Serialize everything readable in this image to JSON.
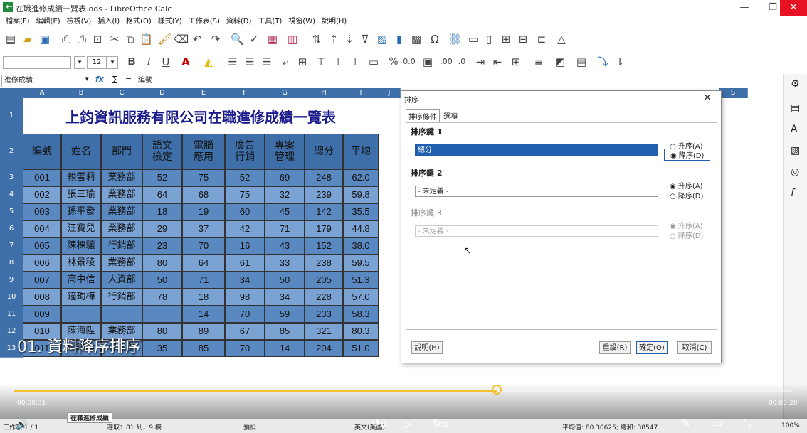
{
  "window": {
    "title": "在職進修成績一覽表.ods - LibreOffice Calc",
    "min_icon": "—",
    "max_icon": "❐",
    "close_icon": "✕",
    "back_icon": "←"
  },
  "menu": [
    "檔案(F)",
    "編輯(E)",
    "檢視(V)",
    "插入(I)",
    "格式(O)",
    "樣式(Y)",
    "工作表(S)",
    "資料(D)",
    "工具(T)",
    "視窗(W)",
    "說明(H)"
  ],
  "font_size": "12",
  "formula": {
    "name_box": "進修成績",
    "fx": "fx",
    "sigma": "∑",
    "equals": "=",
    "content": "編號"
  },
  "columns": [
    "A",
    "B",
    "C",
    "D",
    "E",
    "F",
    "G",
    "H",
    "I",
    "J",
    "S"
  ],
  "sheet_title": "上鈞資訊服務有限公司在職進修成績一覽表",
  "headers": [
    "編號",
    "姓名",
    "部門",
    "語文\n檢定",
    "電腦\n應用",
    "廣告\n行銷",
    "專案\n管理",
    "總分",
    "平均"
  ],
  "rows": [
    [
      "001",
      "賴雪莉",
      "業務部",
      "52",
      "75",
      "52",
      "69",
      "248",
      "62.0"
    ],
    [
      "002",
      "張三瑜",
      "業務部",
      "64",
      "68",
      "75",
      "32",
      "239",
      "59.8"
    ],
    [
      "003",
      "孫平發",
      "業務部",
      "18",
      "19",
      "60",
      "45",
      "142",
      "35.5"
    ],
    [
      "004",
      "汪寶兒",
      "業務部",
      "29",
      "37",
      "42",
      "71",
      "179",
      "44.8"
    ],
    [
      "005",
      "陳棟驤",
      "行銷部",
      "23",
      "70",
      "16",
      "43",
      "152",
      "38.0"
    ],
    [
      "006",
      "林景稜",
      "業務部",
      "80",
      "64",
      "61",
      "33",
      "238",
      "59.5"
    ],
    [
      "007",
      "高中信",
      "人資部",
      "50",
      "71",
      "34",
      "50",
      "205",
      "51.3"
    ],
    [
      "008",
      "鐘珣樺",
      "行銷部",
      "78",
      "18",
      "98",
      "34",
      "228",
      "57.0"
    ],
    [
      "009",
      "",
      "",
      "",
      "14",
      "70",
      "59",
      "233",
      "58.3"
    ],
    [
      "010",
      "陳海陞",
      "業務部",
      "80",
      "89",
      "67",
      "85",
      "321",
      "80.3"
    ],
    [
      "011",
      "吳晌陞",
      "資訊部",
      "35",
      "85",
      "70",
      "14",
      "204",
      "51.0"
    ]
  ],
  "row_numbers": [
    "1",
    "2",
    "3",
    "4",
    "5",
    "6",
    "7",
    "8",
    "9",
    "10",
    "11",
    "12",
    "13"
  ],
  "dialog": {
    "title": "排序",
    "close": "✕",
    "tabs": [
      "排序條件",
      "選項"
    ],
    "key1_label": "排序鍵 1",
    "key1_value": "總分",
    "key2_label": "排序鍵 2",
    "key2_value": "- 未定義 -",
    "key3_label": "排序鍵 3",
    "key3_value": "- 未定義 -",
    "asc": "升序(A)",
    "desc": "降序(D)",
    "help": "說明(H)",
    "reset": "重設(R)",
    "ok": "確定(O)",
    "cancel": "取消(C)"
  },
  "overlay_caption": "01. 資料降序排序",
  "video": {
    "time_current": "00:00:31",
    "time_total": "00:00:20",
    "skip_back": "10",
    "skip_fwd": "30",
    "progress": 0.62
  },
  "status": {
    "sheet_tab": "在職進修成績",
    "sheet_label": "工作表 1 / 1",
    "selection": "選取：81 列，9 欄",
    "style": "預設",
    "lang": "英文(美國)",
    "stats": "平均值: 80.30625; 總和: 38547",
    "zoom": "100%"
  }
}
